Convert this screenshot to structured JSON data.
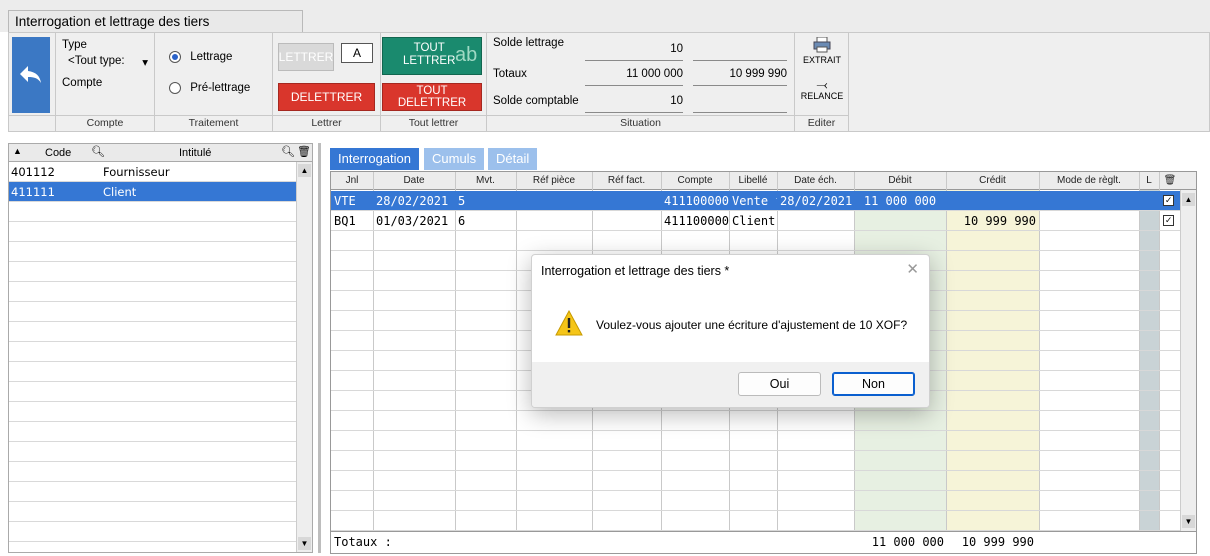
{
  "window": {
    "title": "Interrogation et lettrage des tiers"
  },
  "ribbon": {
    "compte_group": {
      "type_label": "Type",
      "type_value": "<Tout type:",
      "compte_label": "Compte",
      "group_label": "Compte"
    },
    "traitement": {
      "lettrage": "Lettrage",
      "prelettrage": "Pré-lettrage",
      "group_label": "Traitement"
    },
    "lettrer": {
      "lettrer_btn": "LETTRER",
      "letter_box": "A",
      "delettrer_btn": "DELETTRER",
      "group_label": "Lettrer"
    },
    "tout_lettrer": {
      "tout_lettrer_line1": "TOUT",
      "tout_lettrer_line2": "LETTRER",
      "ab": "ab",
      "tout_delettrer": "TOUT DELETTRER",
      "group_label": "Tout lettrer"
    },
    "situation": {
      "solde_lettrage_label": "Solde lettrage",
      "solde_lettrage_value": "10",
      "totaux_label": "Totaux",
      "totaux_debit": "11 000 000",
      "totaux_credit": "10 999 990",
      "solde_comptable_label": "Solde comptable",
      "solde_comptable_value": "10",
      "group_label": "Situation"
    },
    "editer": {
      "extrait": "EXTRAIT",
      "relance": "RELANCE",
      "group_label": "Editer"
    }
  },
  "left_panel": {
    "headers": {
      "code": "Code",
      "intitule": "Intitulé"
    },
    "rows": [
      {
        "code": "401112",
        "intitule": "Fournisseur"
      },
      {
        "code": "411111",
        "intitule": "Client"
      }
    ]
  },
  "tabs": [
    "Interrogation",
    "Cumuls",
    "Détail"
  ],
  "grid": {
    "headers": {
      "jnl": "Jnl",
      "date": "Date",
      "mvt": "Mvt.",
      "ref_piece": "Réf pièce",
      "ref_fact": "Réf fact.",
      "compte": "Compte",
      "libelle": "Libellé",
      "date_ech": "Date éch.",
      "debit": "Débit",
      "credit": "Crédit",
      "mode": "Mode de règlt.",
      "l": "L"
    },
    "rows": [
      {
        "jnl": "VTE",
        "date": "28/02/2021",
        "mvt": "5",
        "compte": "411100000",
        "libelle": "Vente fo",
        "date_ech": "28/02/2021",
        "debit": "11 000 000",
        "credit": ""
      },
      {
        "jnl": "BQ1",
        "date": "01/03/2021",
        "mvt": "6",
        "compte": "411100000",
        "libelle": "Client",
        "date_ech": "",
        "debit": "",
        "credit": "10 999 990"
      }
    ],
    "totals": {
      "label": "Totaux :",
      "debit": "11 000 000",
      "credit": "10 999 990"
    }
  },
  "dialog": {
    "title": "Interrogation et lettrage des tiers *",
    "message": "Voulez-vous ajouter une écriture d'ajustement de 10 XOF?",
    "yes": "Oui",
    "no": "Non"
  },
  "colors": {
    "accent": "#3577d4",
    "red_button": "#d9362c",
    "green_button": "#1a8a6e",
    "debit_col": "#e7f0e2",
    "credit_col": "#f6f4d8"
  }
}
